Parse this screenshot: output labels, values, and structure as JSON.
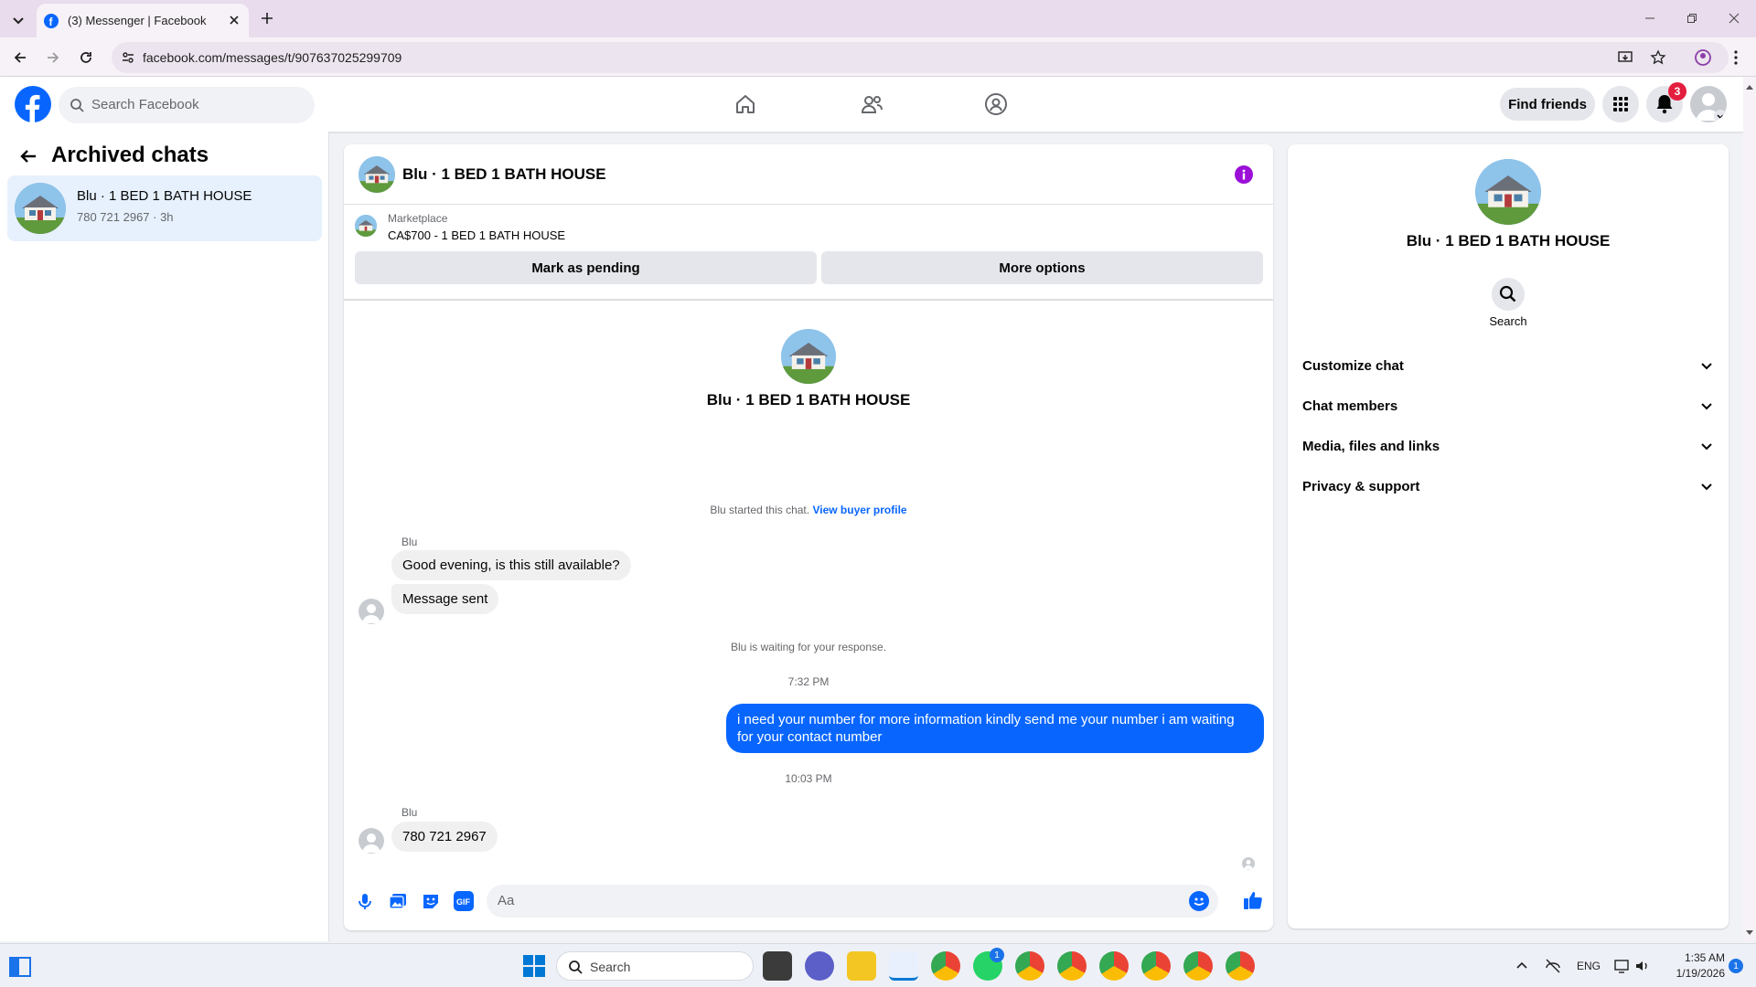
{
  "browser": {
    "tab_title": "(3) Messenger | Facebook",
    "url": "facebook.com/messages/t/907637025299709"
  },
  "fb_header": {
    "search_placeholder": "Search Facebook",
    "find_friends": "Find friends",
    "notif_count": "3",
    "accent": "#0866ff"
  },
  "left": {
    "title": "Archived chats",
    "chats": [
      {
        "name": "Blu · 1 BED 1 BATH HOUSE",
        "preview": "780 721 2967 · 3h"
      }
    ]
  },
  "chat": {
    "header_name": "Blu · 1 BED 1 BATH HOUSE",
    "marketplace_label": "Marketplace",
    "listing": "CA$700 - 1 BED 1 BATH HOUSE",
    "mark_pending": "Mark as pending",
    "more_options": "More options",
    "intro_name": "Blu · 1 BED 1 BATH HOUSE",
    "started_text": "Blu started this chat.",
    "view_profile": "View buyer profile",
    "messages": [
      {
        "sender": "Blu",
        "text": "Good evening, is this still available?"
      },
      {
        "text": "Message sent"
      }
    ],
    "waiting_text": "Blu is waiting for your response.",
    "time1": "7:32 PM",
    "outgoing": "i need your number for more information kindly send me your number i am waiting for your contact number",
    "time2": "10:03 PM",
    "reply_sender": "Blu",
    "reply_text": "780 721 2967",
    "composer_placeholder": "Aa"
  },
  "right": {
    "name": "Blu · 1 BED 1 BATH HOUSE",
    "search_label": "Search",
    "sections": [
      "Customize chat",
      "Chat members",
      "Media, files and links",
      "Privacy & support"
    ]
  },
  "taskbar": {
    "search_placeholder": "Search",
    "lang": "ENG",
    "time": "1:35 AM",
    "date": "1/19/2026",
    "badge": "1"
  }
}
